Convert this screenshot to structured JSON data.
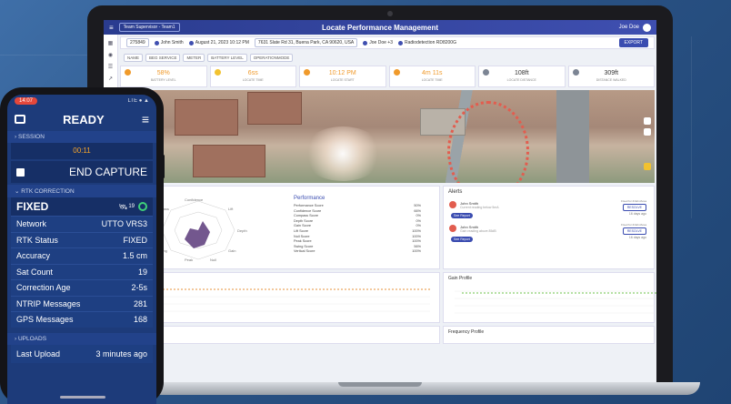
{
  "colors": {
    "brand": "#3a4cb0",
    "accent": "#f09a2b",
    "alert": "#e25d4f",
    "ok": "#3fd07a",
    "phone_bg": "#1d3b7a"
  },
  "laptop": {
    "header": {
      "team": "Team Supervisor - Team1",
      "title": "Locate Performance Management",
      "user": "Joe Doe"
    },
    "info_bar": {
      "job_id": "275849",
      "operator": "John Smith",
      "date": "August 21, 2023 10:12 PM",
      "address": "7631 Slate Rd 31, Buena Park, CA 90620, USA",
      "team": "Joe Doe +3",
      "device": "Radiodetection RD8200G",
      "export_label": "EXPORT"
    },
    "filters": [
      "NAME",
      "BEG SERVICE",
      "METER",
      "BATTERY LEVEL",
      "OPERATIONMODE"
    ],
    "stats": [
      {
        "value": "58%",
        "label": "Battery Level",
        "color": "#f09a2b"
      },
      {
        "value": "6ss",
        "label": "Locate Time",
        "color": "#f2c230"
      },
      {
        "value": "10:12 PM",
        "label": "Locate Start",
        "color": "#f09a2b"
      },
      {
        "value": "4m 11s",
        "label": "Locate Time",
        "color": "#f09a2b"
      },
      {
        "value": "108ft",
        "label": "Locate Distance",
        "color": "#333333"
      },
      {
        "value": "309ft",
        "label": "Distance Walked",
        "color": "#333333"
      }
    ],
    "performance": {
      "title": "Performance",
      "rows": [
        {
          "name": "Performance Score",
          "value": "50%"
        },
        {
          "name": "Confidence Score",
          "value": "66%"
        },
        {
          "name": "Compass Score",
          "value": "0%"
        },
        {
          "name": "Depth Score",
          "value": "0%"
        },
        {
          "name": "Gain Score",
          "value": "0%"
        },
        {
          "name": "Lift Score",
          "value": "100%"
        },
        {
          "name": "Null Score",
          "value": "100%"
        },
        {
          "name": "Peak Score",
          "value": "100%"
        },
        {
          "name": "Swing Score",
          "value": "56%"
        },
        {
          "name": "Vertical Score",
          "value": "100%"
        }
      ],
      "radar_labels": [
        "Confidence",
        "Lift",
        "Depth",
        "Gain",
        "Null",
        "Peak",
        "Swing",
        "Vertical",
        "Compass"
      ]
    },
    "alerts": {
      "title": "Alerts",
      "items": [
        {
          "name": "John Smith",
          "detail": "Current reading below 5mA",
          "tag": "See Report",
          "action": "RESOLVE",
          "when": "16 days ago",
          "owner": "Fixed for #John/Area"
        },
        {
          "name": "John Smith",
          "detail": "Gain reading above 85dB",
          "tag": "See Report",
          "action": "RESOLVE",
          "when": "16 days ago",
          "owner": "Fixed for #John/Area"
        }
      ]
    },
    "charts": {
      "gain_title": "Gain Profile",
      "freq_title": "Frequency Profile"
    }
  },
  "phone": {
    "time": "14:07",
    "status_icons": "LTE ● ▲",
    "header_title": "READY",
    "session_label": "SESSION",
    "timer": "00:11",
    "end_capture": "END CAPTURE",
    "rtk_label": "RTK CORRECTION",
    "fix_status": "FIXED",
    "sat_count_badge": "19",
    "rows": [
      {
        "key": "Network",
        "value": "UTTO VRS3"
      },
      {
        "key": "RTK Status",
        "value": "FIXED"
      },
      {
        "key": "Accuracy",
        "value": "1.5 cm"
      },
      {
        "key": "Sat Count",
        "value": "19"
      },
      {
        "key": "Correction Age",
        "value": "2-5s"
      },
      {
        "key": "NTRIP Messages",
        "value": "281"
      },
      {
        "key": "GPS Messages",
        "value": "168"
      }
    ],
    "uploads_label": "UPLOADS",
    "last_upload_key": "Last Upload",
    "last_upload_value": "3 minutes ago"
  }
}
